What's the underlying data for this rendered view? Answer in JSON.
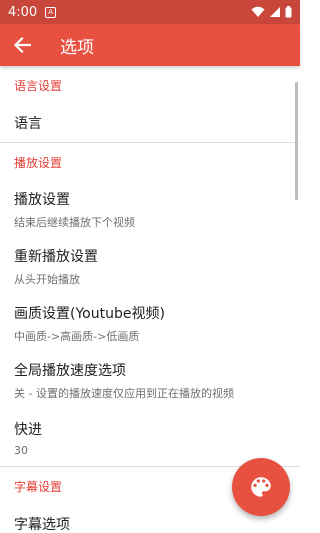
{
  "status_bar": {
    "time": "4:00"
  },
  "app_bar": {
    "title": "选项"
  },
  "sections": [
    {
      "header": "语言设置",
      "items": [
        {
          "title": "语言",
          "subtitle": ""
        }
      ]
    },
    {
      "header": "播放设置",
      "items": [
        {
          "title": "播放设置",
          "subtitle": "结束后继续播放下个视频"
        },
        {
          "title": "重新播放设置",
          "subtitle": "从头开始播放"
        },
        {
          "title": "画质设置(Youtube视频)",
          "subtitle": "中画质->高画质->低画质"
        },
        {
          "title": "全局播放速度选项",
          "subtitle": "关 - 设置的播放速度仅应用到正在播放的视频"
        },
        {
          "title": "快进",
          "subtitle": "30"
        }
      ]
    },
    {
      "header": "字幕设置",
      "items": [
        {
          "title": "字幕选项",
          "subtitle": ""
        }
      ]
    }
  ],
  "colors": {
    "primary": "#e8503f",
    "status_bar": "#c9463a",
    "accent_text": "#e53e35"
  },
  "icons": {
    "back": "arrow-left-icon",
    "fab": "palette-icon"
  }
}
